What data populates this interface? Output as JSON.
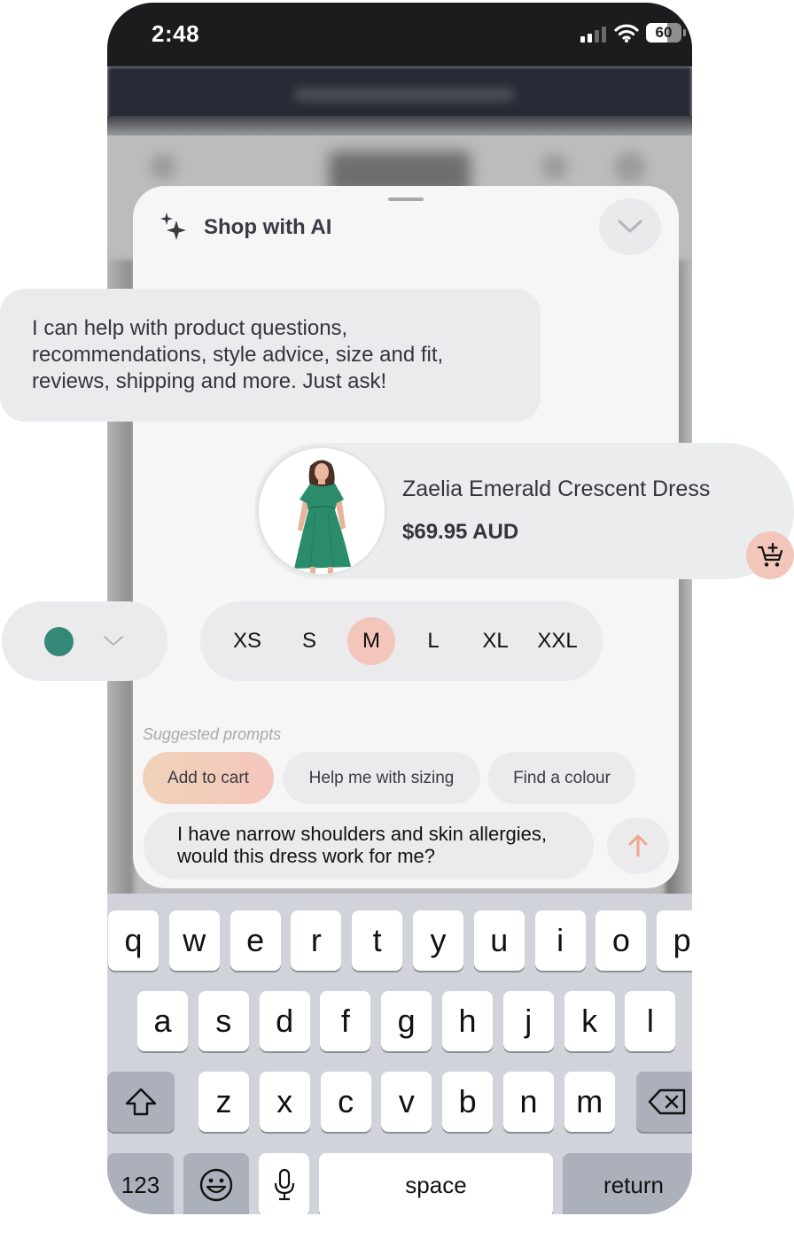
{
  "status_bar": {
    "time": "2:48",
    "signal_bars_active": 2,
    "signal_bars_total": 4,
    "wifi_icon": "wifi-icon",
    "battery_level": "60"
  },
  "chat": {
    "title": "Shop with AI",
    "title_icon": "sparkle-icon",
    "collapse_icon": "chevron-down-icon",
    "assistant_message": "I can help with product questions, recommendations, style advice, size and fit, reviews, shipping and more. Just ask!",
    "product": {
      "name": "Zaelia Emerald Crescent Dress",
      "price": "$69.95 AUD",
      "image_alt": "Woman wearing emerald green midi dress",
      "add_to_cart_icon": "cart-plus-icon"
    },
    "color": {
      "selected_hex": "#348877",
      "dropdown_icon": "chevron-down-icon"
    },
    "sizes": {
      "options": [
        "XS",
        "S",
        "M",
        "L",
        "XL",
        "XXL"
      ],
      "selected": "M"
    },
    "suggested_prompts_label": "Suggested prompts",
    "suggested_prompts": [
      "Add to cart",
      "Help me with sizing",
      "Find a colour"
    ],
    "input_value": "I have narrow shoulders and skin allergies, would this dress work for me?",
    "send_icon": "arrow-up-icon"
  },
  "keyboard": {
    "row1": [
      "q",
      "w",
      "e",
      "r",
      "t",
      "y",
      "u",
      "i",
      "o",
      "p"
    ],
    "row2": [
      "a",
      "s",
      "d",
      "f",
      "g",
      "h",
      "j",
      "k",
      "l"
    ],
    "row3": [
      "z",
      "x",
      "c",
      "v",
      "b",
      "n",
      "m"
    ],
    "numbers_label": "123",
    "space_label": "space",
    "return_label": "return"
  },
  "colors": {
    "accent_peach": "#f3c6bb",
    "send_arrow": "#f1a592",
    "sheet_bg": "#f6f6f6",
    "bubble_bg": "#ebebed"
  }
}
